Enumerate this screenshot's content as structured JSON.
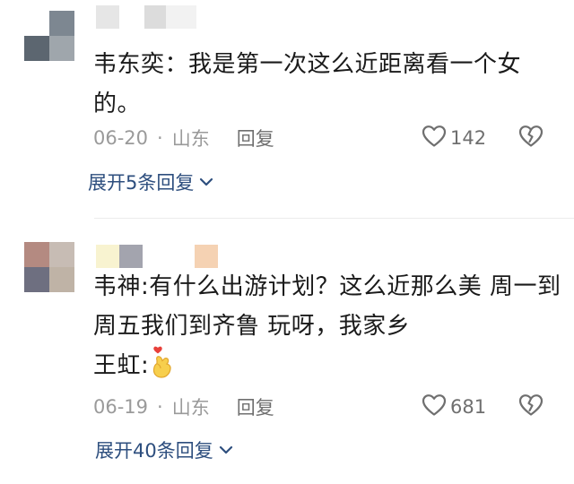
{
  "comments": [
    {
      "text_lines": [
        "韦东奕：我是第一次这么近距离看一个女",
        "的。"
      ],
      "date": "06-20",
      "location": "山东",
      "reply_label": "回复",
      "like_count": "142",
      "expand_label": "展开5条回复",
      "avatar_colors": [
        "#ffffff",
        "#7d8791",
        "#5c6670",
        "#9fa6ac"
      ],
      "name_colors": [
        "#e6e6e6",
        "#dcdcdc",
        "#f2f2f2"
      ]
    },
    {
      "text_lines": [
        "韦神:有什么出游计划？这么近那么美 周一到",
        "周五我们到齐鲁 玩呀，我家乡",
        "王虹:"
      ],
      "date": "06-19",
      "location": "山东",
      "reply_label": "回复",
      "like_count": "681",
      "expand_label": "展开40条回复",
      "avatar_colors": [
        "#b48a81",
        "#c7bcb4",
        "#6e6f80",
        "#bfb3a6"
      ],
      "name_colors": [
        "#f8f3d0",
        "#a3a4ae",
        "#f5d2b3"
      ]
    }
  ],
  "icons": {
    "like": "heart-outline-icon",
    "dislike": "broken-heart-icon",
    "expand": "chevron-down-icon",
    "emoji": "finger-heart-emoji-icon"
  },
  "colors": {
    "link": "#2d4e7e",
    "meta": "#9a9a9a",
    "icon": "#6f6f6f"
  }
}
